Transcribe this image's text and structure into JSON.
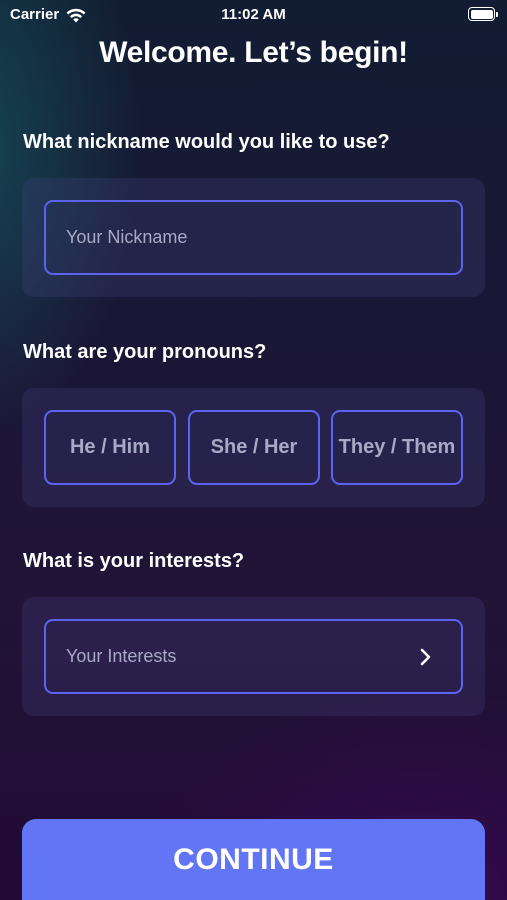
{
  "status_bar": {
    "carrier": "Carrier",
    "time": "11:02 AM",
    "icons": [
      "wifi-icon",
      "battery-icon"
    ]
  },
  "header": {
    "title": "Welcome. Let’s begin!"
  },
  "nickname": {
    "question": "What nickname would you like to use?",
    "placeholder": "Your Nickname",
    "value": ""
  },
  "pronouns": {
    "question": "What are your pronouns?",
    "options": [
      "He / Him",
      "She / Her",
      "They / Them"
    ]
  },
  "interests": {
    "question": "What is your interests?",
    "placeholder": "Your Interests",
    "icon": "chevron-right-icon"
  },
  "footer": {
    "continue_label": "CONTINUE"
  },
  "colors": {
    "accent": "#5b63f0",
    "button": "#6276f5",
    "placeholder_text": "#a7a9c6"
  }
}
